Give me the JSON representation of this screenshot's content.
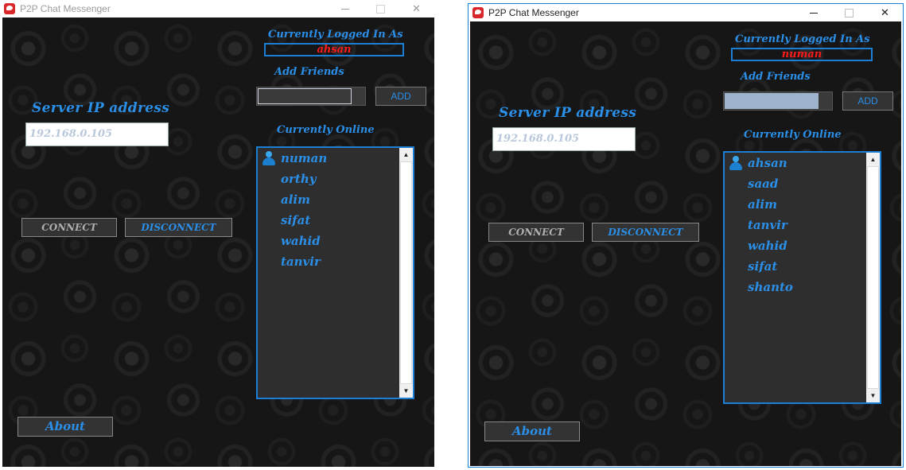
{
  "windows": [
    {
      "title": "P2P Chat Messenger",
      "currently_logged_in_label": "Currently Logged In As",
      "logged_in_user": "ahsan",
      "add_friends_label": "Add Friends",
      "add_input_value": "",
      "add_button": "ADD",
      "currently_online_label": "Currently Online",
      "online_users": [
        "numan",
        "orthy",
        "alim",
        "sifat",
        "wahid",
        "tanvir"
      ],
      "server_ip_label": "Server IP address",
      "server_ip_value": "192.168.0.105",
      "connect_button": "CONNECT",
      "disconnect_button": "DISCONNECT",
      "about_button": "About",
      "focused": false
    },
    {
      "title": "P2P Chat Messenger",
      "currently_logged_in_label": "Currently Logged In As",
      "logged_in_user": "numan",
      "add_friends_label": "Add Friends",
      "add_input_value": "",
      "add_button": "ADD",
      "currently_online_label": "Currently Online",
      "online_users": [
        "ahsan",
        "saad",
        "alim",
        "tanvir",
        "wahid",
        "sifat",
        "shanto"
      ],
      "server_ip_label": "Server IP address",
      "server_ip_value": "192.168.0.105",
      "connect_button": "CONNECT",
      "disconnect_button": "DISCONNECT",
      "about_button": "About",
      "focused": true
    }
  ],
  "colors": {
    "accent_blue": "#2b8fe8",
    "border_blue": "#1b7fd6",
    "logged_user_red": "#ff1a1a",
    "background": "#161616"
  }
}
